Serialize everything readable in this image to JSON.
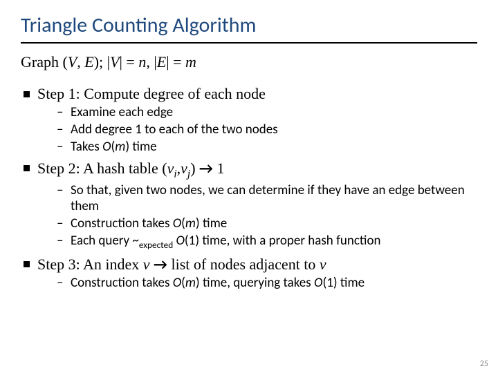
{
  "title": "Triangle Counting Algorithm",
  "sub_pre": "Graph (",
  "sub_V": "V",
  "sub_comma1": ", ",
  "sub_E": "E",
  "sub_mid1": "); |",
  "sub_V2": "V",
  "sub_mid2": "| = ",
  "sub_n": "n",
  "sub_mid3": ", |",
  "sub_E2": "E",
  "sub_mid4": "| = ",
  "sub_m": "m",
  "step1": "Step 1: Compute degree of each node",
  "s1a": "Examine each edge",
  "s1b": "Add degree 1 to each of the two nodes",
  "s1c_pre": "Takes ",
  "s1c_O": "O",
  "s1c_paren": "(",
  "s1c_m": "m",
  "s1c_post": ") time",
  "step2_pre": "Step 2: A hash table (",
  "step2_vi": "v",
  "step2_i": "i",
  "step2_c": ",",
  "step2_vj": "v",
  "step2_j": "j",
  "step2_close": ") ",
  "arrow": "→",
  "step2_post": " 1",
  "s2a": "So that, given two nodes, we can determine if they have an edge between them",
  "s2b_pre": "Construction takes ",
  "s2b_O": "O",
  "s2b_paren": "(",
  "s2b_m": "m",
  "s2b_post": ") time",
  "s2c_pre": "Each query ~",
  "s2c_exp": "expected",
  "s2c_sp": " ",
  "s2c_O": "O",
  "s2c_post": "(1) time, with a proper hash function",
  "step3_pre": "Step 3: An index ",
  "step3_v": "v",
  "step3_sp": " ",
  "step3_post": " list of nodes adjacent to ",
  "step3_v2": "v",
  "s3a_pre": "Construction takes ",
  "s3a_O": "O",
  "s3a_paren": "(",
  "s3a_m": "m",
  "s3a_mid": ") time, querying takes ",
  "s3a_O2": "O",
  "s3a_post": "(1) time",
  "pagenum": "25"
}
